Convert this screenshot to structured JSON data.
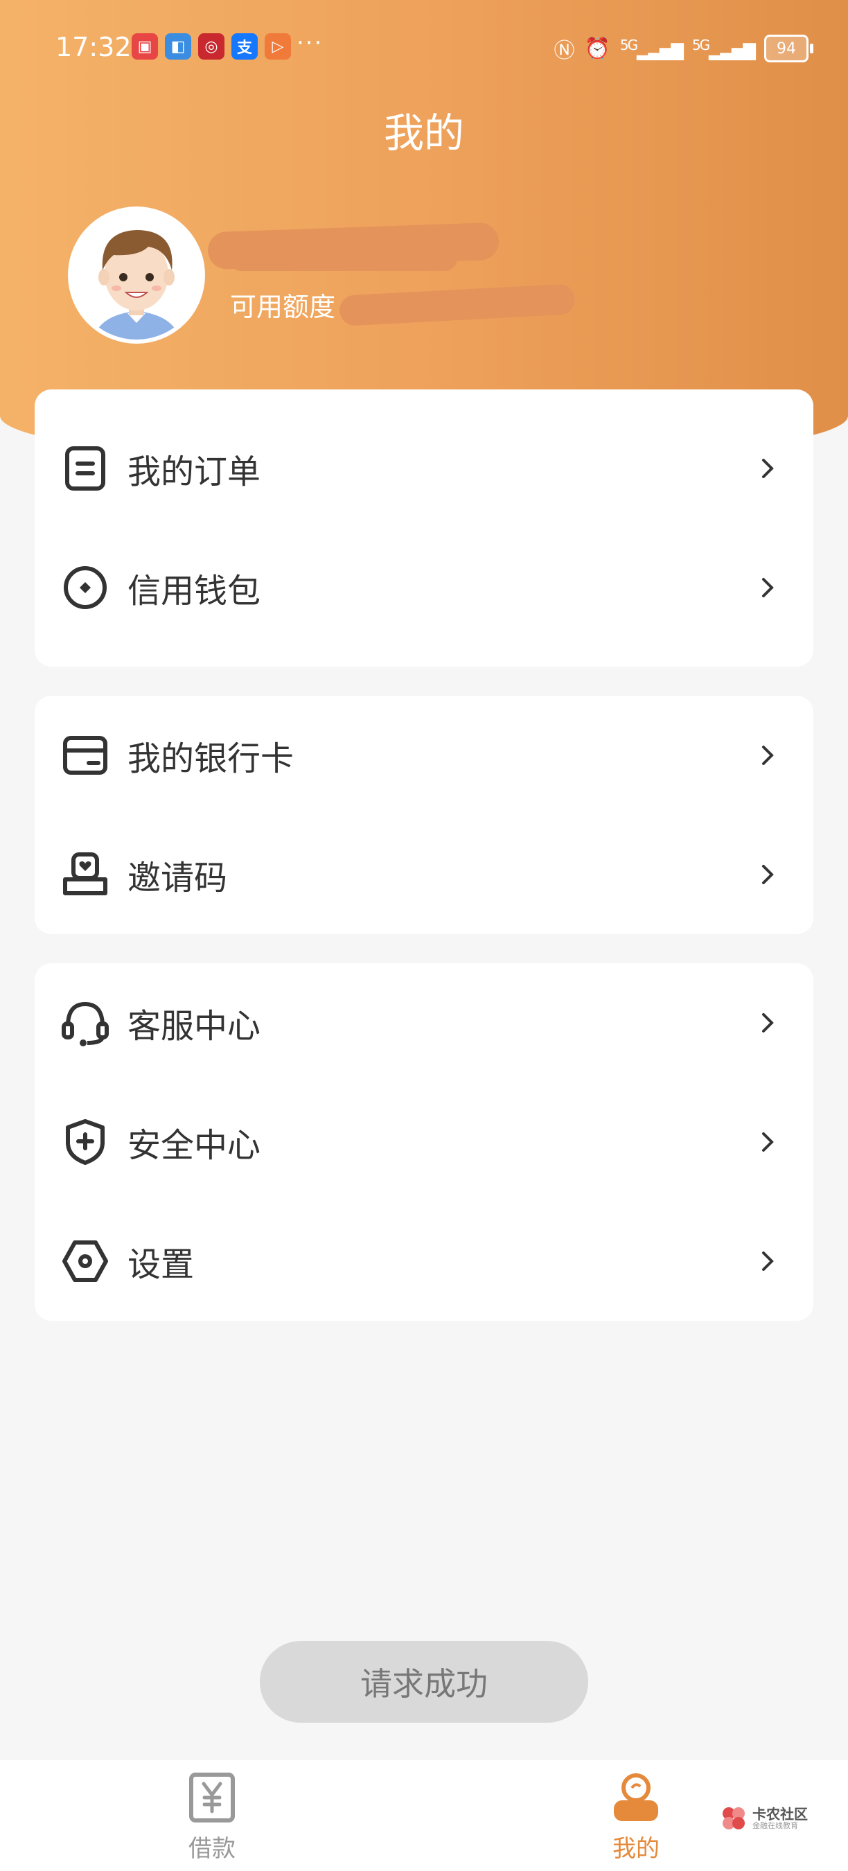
{
  "status_bar": {
    "time": "17:32",
    "more": "···",
    "network_1": "5G",
    "network_2": "5G",
    "battery": "94"
  },
  "header": {
    "title": "我的",
    "credit_label": "可用额度"
  },
  "menu_groups": [
    [
      {
        "label": "我的订单",
        "icon": "order-icon"
      },
      {
        "label": "信用钱包",
        "icon": "wallet-icon"
      }
    ],
    [
      {
        "label": "我的银行卡",
        "icon": "bank-card-icon"
      },
      {
        "label": "邀请码",
        "icon": "invite-icon"
      }
    ],
    [
      {
        "label": "客服中心",
        "icon": "headset-icon"
      },
      {
        "label": "安全中心",
        "icon": "shield-icon"
      },
      {
        "label": "设置",
        "icon": "settings-icon"
      }
    ]
  ],
  "toast": "请求成功",
  "tabbar": {
    "loan": "借款",
    "mine": "我的"
  },
  "watermark": {
    "title": "卡农社区",
    "subtitle": "金融在线教育"
  },
  "colors": {
    "accent": "#ef9a4c",
    "header_start": "#f4b268",
    "header_end": "#e08f48",
    "tab_active": "#e5893a",
    "tab_inactive": "#999999"
  }
}
